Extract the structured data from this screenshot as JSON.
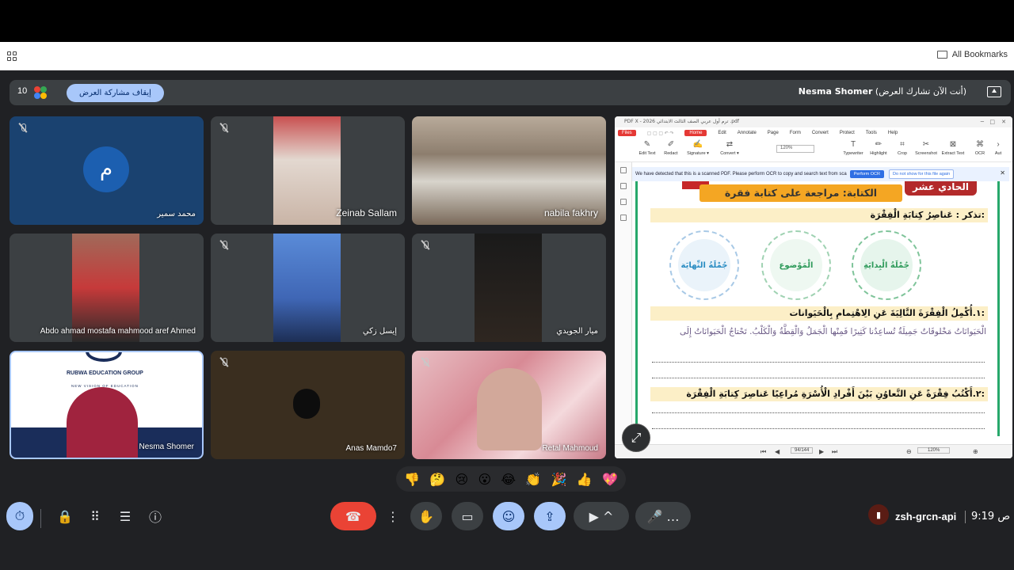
{
  "browser": {
    "all_bookmarks": "All Bookmarks"
  },
  "banner": {
    "participant_count": "10",
    "stop_presenting": "إيقاف مشاركة العرض",
    "presenter_name": "Nesma Shomer",
    "presenter_status": "(أنت الآن تشارك العرض)"
  },
  "tiles": [
    {
      "name": "محمد سمير",
      "avatar_letter": "م"
    },
    {
      "name": "Zeinab Sallam"
    },
    {
      "name": "nabila fakhry"
    },
    {
      "name": "Abdo ahmad mostafa mahmood aref Ahmed"
    },
    {
      "name": "إيسل زكي"
    },
    {
      "name": "ميار الجويدي"
    },
    {
      "name": "Nesma Shomer",
      "logo_text": "RUBWA EDUCATION GROUP",
      "logo_sub": "NEW VISION OF EDUCATION"
    },
    {
      "name": "Anas Mamdo7"
    },
    {
      "name": "Retal Mahmoud"
    }
  ],
  "pdf": {
    "title": "PDF X - 2026 ترم أول  عربي الصف الثالث الابتدائي .pdf",
    "menu": [
      "Files",
      "Home",
      "Edit",
      "Annotate",
      "Page",
      "Form",
      "Convert",
      "Protect",
      "Tools",
      "Help"
    ],
    "tools": [
      "Edit Text",
      "Redact",
      "Signature ▾",
      "Convert ▾",
      "Typewriter",
      "Highlight",
      "Crop",
      "Screenshot",
      "Extract Text",
      "OCR",
      "Aut"
    ],
    "zoom": "120%",
    "ocr_notice": "We have detected that this is a scanned PDF.  Please perform OCR to copy and search text from sca",
    "ocr_button": "Perform OCR",
    "dismiss_button": "Do not show for this file again",
    "page_indicator": "94/144",
    "status_zoom": "120%"
  },
  "page": {
    "lesson": "الحادي عشر",
    "title": "الكتابة: مراجعة على كتابة فقرة",
    "remember": "تذكر : عَناصِرُ كِتابَةِ الْفِقْرَة:",
    "circles": [
      "جُمْلَةُ الْبِدايَةِ",
      "الْمَوْضوع",
      "جُمْلَةُ النِّهايَة"
    ],
    "q1": "١.أُكْمِلُ الْفِقْرَةَ التَّالِيَةَ عَنِ الِاهْتِمامِ بِالْحَيَوانات:",
    "q1_text": "الْحَيَوانَاتُ مَخْلوقَاتٌ جَمِيلَةٌ تُساعِدُنا كَثِيرًا فَمِنْها الْجَمَلُ وَالْقِطَّةُ وَالْكَلْبُ. تَحْتاجُ الْحَيَوانَاتُ إِلَى",
    "q2": "٢.أَكْتُبُ فِقْرَةً عَنِ التَّعاوُنِ بَيْنَ أَفْرادِ الْأُسْرَةِ مُراعِيًا عَناصِرَ كِتابَةِ الْفِقْرَة:"
  },
  "reactions": [
    "👎",
    "🤔",
    "😢",
    "😮",
    "😂",
    "👏",
    "🎉",
    "👍",
    "💖"
  ],
  "footer": {
    "meeting_code": "zsh-grcn-api",
    "time": "9:19 ص"
  },
  "colors": {
    "meet_bg": "#202124",
    "tile_bg": "#3c4043",
    "accent_blue": "#a8c7fa",
    "end_call_red": "#ea4335",
    "page_title_orange": "#f4a623",
    "lesson_red": "#b32a2a"
  }
}
